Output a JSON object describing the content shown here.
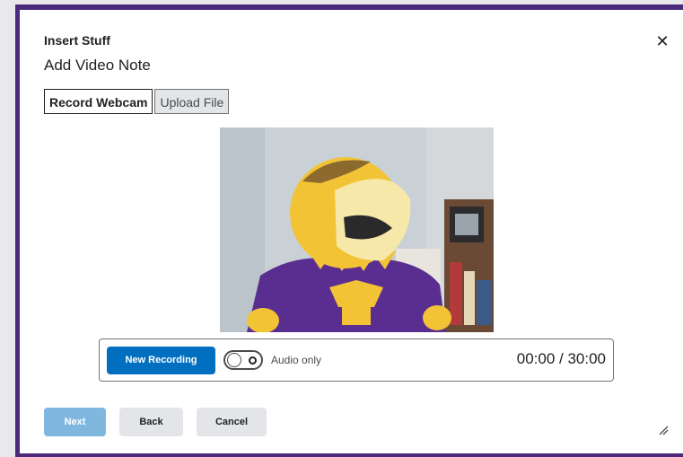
{
  "dialog": {
    "header_title": "Insert Stuff",
    "sub_title": "Add Video Note",
    "close_icon": "close-icon"
  },
  "tabs": [
    {
      "label": "Record Webcam",
      "active": true
    },
    {
      "label": "Upload File",
      "active": false
    }
  ],
  "video": {
    "description_icon": "webcam-preview"
  },
  "controls": {
    "new_recording_label": "New Recording",
    "audio_only_label": "Audio only",
    "audio_only_on": false,
    "timer": "00:00 / 30:00"
  },
  "footer": {
    "next_label": "Next",
    "back_label": "Back",
    "cancel_label": "Cancel"
  },
  "colors": {
    "frame": "#4b2a7e",
    "primary": "#006fbf",
    "primary_disabled": "#7fb7df",
    "secondary": "#e3e5e8"
  }
}
